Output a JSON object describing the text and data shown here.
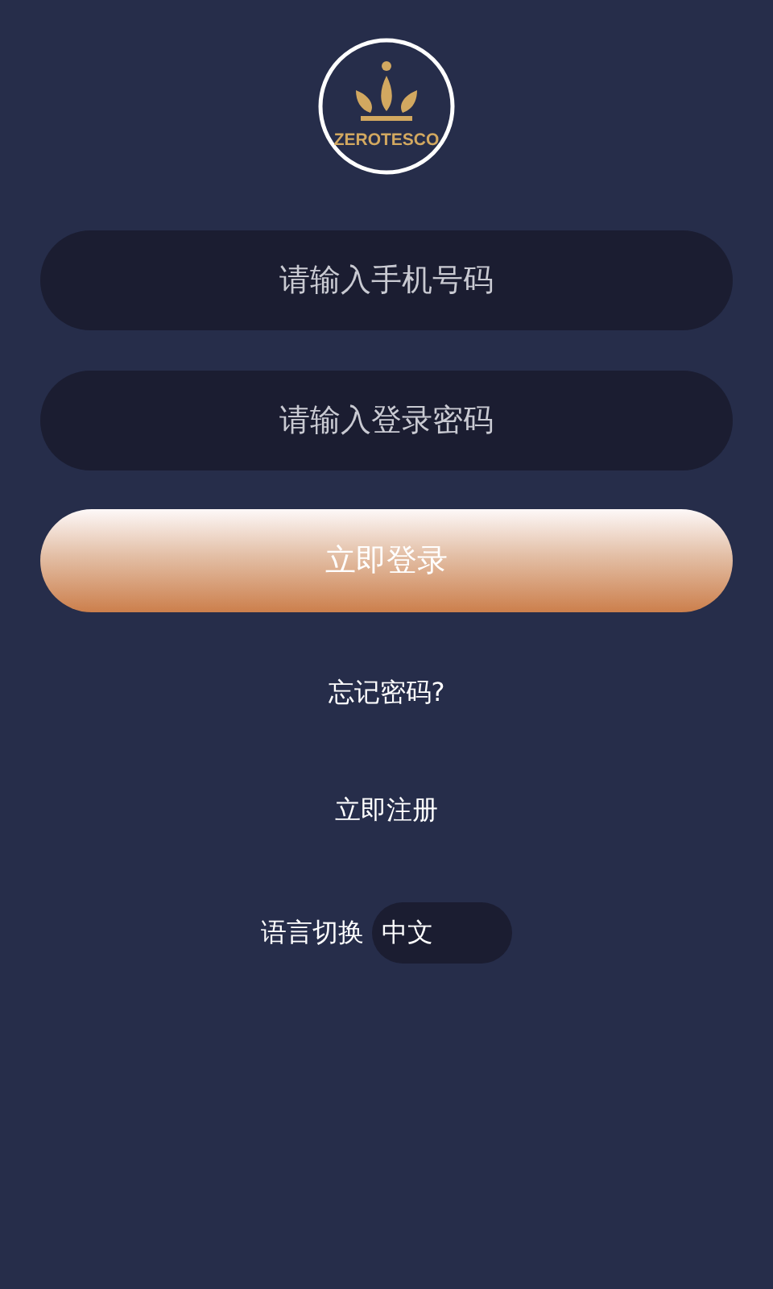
{
  "logo": {
    "text": "ZEROTESCO"
  },
  "phone_field": {
    "placeholder": "请输入手机号码"
  },
  "password_field": {
    "placeholder": "请输入登录密码"
  },
  "login_button": {
    "label": "立即登录"
  },
  "forgot_link": {
    "label": "忘记密码?"
  },
  "register_link": {
    "label": "立即注册"
  },
  "language": {
    "label": "语言切换",
    "value": "中文"
  }
}
